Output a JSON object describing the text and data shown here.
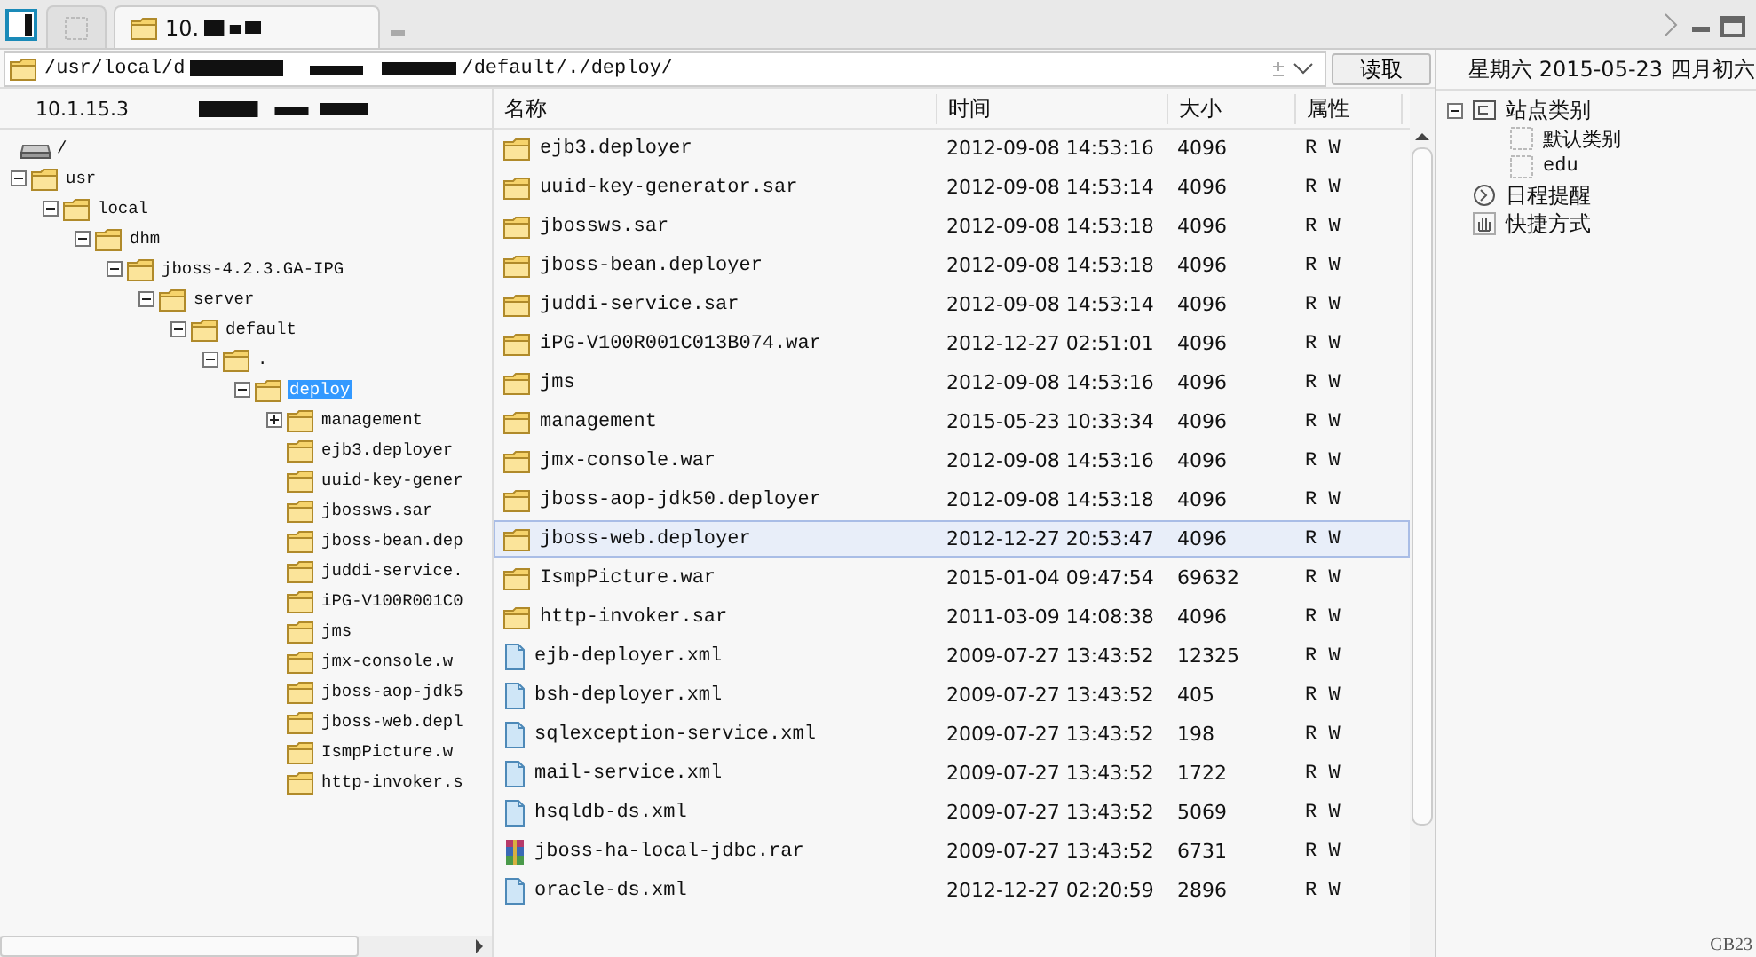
{
  "tab": {
    "title": "10.",
    "selected": true
  },
  "path": {
    "start": "/usr/local/d",
    "end": "/default/./deploy/"
  },
  "read_button": "读取",
  "host": "10.1.15.3",
  "tree": {
    "label": "/",
    "kind": "drive",
    "selected": false,
    "children": [
      {
        "label": "usr",
        "kind": "folder",
        "selected": false,
        "expanded": true,
        "children": [
          {
            "label": "local",
            "kind": "folder",
            "selected": false,
            "expanded": true,
            "children": [
              {
                "label": "dhm",
                "kind": "folder",
                "selected": false,
                "expanded": true,
                "children": [
                  {
                    "label": "jboss-4.2.3.GA-IPG",
                    "kind": "folder",
                    "selected": false,
                    "expanded": true,
                    "children": [
                      {
                        "label": "server",
                        "kind": "folder",
                        "selected": false,
                        "expanded": true,
                        "children": [
                          {
                            "label": "default",
                            "kind": "folder",
                            "selected": false,
                            "expanded": true,
                            "children": [
                              {
                                "label": ".",
                                "kind": "folder",
                                "selected": false,
                                "expanded": true,
                                "children": [
                                  {
                                    "label": "deploy",
                                    "kind": "folder",
                                    "selected": true,
                                    "expanded": true,
                                    "children": [
                                      {
                                        "label": "management",
                                        "kind": "folder",
                                        "selected": false,
                                        "expanded": false
                                      },
                                      {
                                        "label": "ejb3.deployer",
                                        "kind": "folder",
                                        "selected": false
                                      },
                                      {
                                        "label": "uuid-key-gener",
                                        "kind": "folder",
                                        "selected": false
                                      },
                                      {
                                        "label": "jbossws.sar",
                                        "kind": "folder",
                                        "selected": false
                                      },
                                      {
                                        "label": "jboss-bean.dep",
                                        "kind": "folder",
                                        "selected": false
                                      },
                                      {
                                        "label": "juddi-service.",
                                        "kind": "folder",
                                        "selected": false
                                      },
                                      {
                                        "label": "iPG-V100R001C0",
                                        "kind": "folder",
                                        "selected": false
                                      },
                                      {
                                        "label": "jms",
                                        "kind": "folder",
                                        "selected": false
                                      },
                                      {
                                        "label": "jmx-console.w",
                                        "kind": "folder",
                                        "selected": false
                                      },
                                      {
                                        "label": "jboss-aop-jdk5",
                                        "kind": "folder",
                                        "selected": false
                                      },
                                      {
                                        "label": "jboss-web.depl",
                                        "kind": "folder",
                                        "selected": false
                                      },
                                      {
                                        "label": "IsmpPicture.w",
                                        "kind": "folder",
                                        "selected": false
                                      },
                                      {
                                        "label": "http-invoker.s",
                                        "kind": "folder",
                                        "selected": false
                                      }
                                    ]
                                  }
                                ]
                              }
                            ]
                          }
                        ]
                      }
                    ]
                  }
                ]
              }
            ]
          }
        ]
      }
    ]
  },
  "table": {
    "columns": [
      "名称",
      "时间",
      "大小",
      "属性"
    ],
    "rows": [
      {
        "kind": "folder",
        "selected": false,
        "cells": [
          "ejb3.deployer",
          "2012-09-08 14:53:16",
          "4096",
          "R W"
        ]
      },
      {
        "kind": "folder",
        "selected": false,
        "cells": [
          "uuid-key-generator.sar",
          "2012-09-08 14:53:14",
          "4096",
          "R W"
        ]
      },
      {
        "kind": "folder",
        "selected": false,
        "cells": [
          "jbossws.sar",
          "2012-09-08 14:53:18",
          "4096",
          "R W"
        ]
      },
      {
        "kind": "folder",
        "selected": false,
        "cells": [
          "jboss-bean.deployer",
          "2012-09-08 14:53:18",
          "4096",
          "R W"
        ]
      },
      {
        "kind": "folder",
        "selected": false,
        "cells": [
          "juddi-service.sar",
          "2012-09-08 14:53:14",
          "4096",
          "R W"
        ]
      },
      {
        "kind": "folder",
        "selected": false,
        "cells": [
          "iPG-V100R001C013B074.war",
          "2012-12-27 02:51:01",
          "4096",
          "R W"
        ]
      },
      {
        "kind": "folder",
        "selected": false,
        "cells": [
          "jms",
          "2012-09-08 14:53:16",
          "4096",
          "R W"
        ]
      },
      {
        "kind": "folder",
        "selected": false,
        "cells": [
          "management",
          "2015-05-23 10:33:34",
          "4096",
          "R W"
        ]
      },
      {
        "kind": "folder",
        "selected": false,
        "cells": [
          "jmx-console.war",
          "2012-09-08 14:53:16",
          "4096",
          "R W"
        ]
      },
      {
        "kind": "folder",
        "selected": false,
        "cells": [
          "jboss-aop-jdk50.deployer",
          "2012-09-08 14:53:18",
          "4096",
          "R W"
        ]
      },
      {
        "kind": "folder",
        "selected": true,
        "cells": [
          "jboss-web.deployer",
          "2012-12-27 20:53:47",
          "4096",
          "R W"
        ]
      },
      {
        "kind": "folder",
        "selected": false,
        "cells": [
          "IsmpPicture.war",
          "2015-01-04 09:47:54",
          "69632",
          "R W"
        ]
      },
      {
        "kind": "folder",
        "selected": false,
        "cells": [
          "http-invoker.sar",
          "2011-03-09 14:08:38",
          "4096",
          "R W"
        ]
      },
      {
        "kind": "file",
        "selected": false,
        "cells": [
          "ejb-deployer.xml",
          "2009-07-27 13:43:52",
          "12325",
          "R W"
        ]
      },
      {
        "kind": "file",
        "selected": false,
        "cells": [
          "bsh-deployer.xml",
          "2009-07-27 13:43:52",
          "405",
          "R W"
        ]
      },
      {
        "kind": "file",
        "selected": false,
        "cells": [
          "sqlexception-service.xml",
          "2009-07-27 13:43:52",
          "198",
          "R W"
        ]
      },
      {
        "kind": "file",
        "selected": false,
        "cells": [
          "mail-service.xml",
          "2009-07-27 13:43:52",
          "1722",
          "R W"
        ]
      },
      {
        "kind": "file",
        "selected": false,
        "cells": [
          "hsqldb-ds.xml",
          "2009-07-27 13:43:52",
          "5069",
          "R W"
        ]
      },
      {
        "kind": "archive",
        "selected": false,
        "cells": [
          "jboss-ha-local-jdbc.rar",
          "2009-07-27 13:43:52",
          "6731",
          "R W"
        ]
      },
      {
        "kind": "file",
        "selected": false,
        "cells": [
          "oracle-ds.xml",
          "2012-12-27 02:20:59",
          "2896",
          "R W"
        ]
      }
    ]
  },
  "date_line": "星期六 2015-05-23 四月初六",
  "side_tree": [
    {
      "label": "站点类别",
      "kind": "category",
      "expanded": true,
      "children": [
        {
          "label": "默认类别",
          "kind": "item"
        },
        {
          "label": "edu",
          "kind": "item"
        }
      ]
    },
    {
      "label": "日程提醒",
      "kind": "reminder"
    },
    {
      "label": "快捷方式",
      "kind": "shortcut"
    }
  ],
  "status_text": "GB23"
}
